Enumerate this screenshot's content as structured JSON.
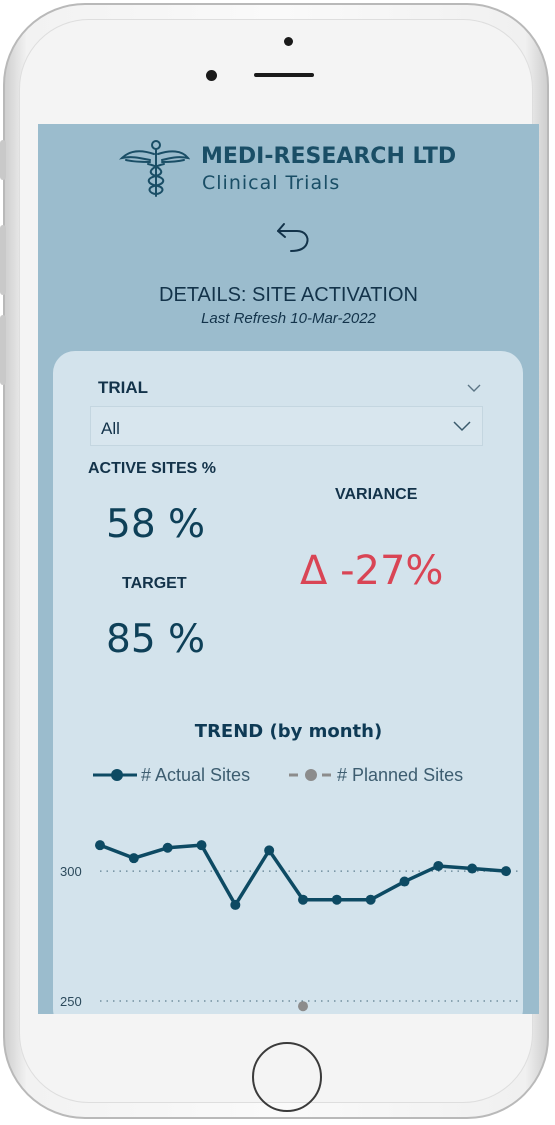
{
  "app": {
    "brand_name": "MEDI-RESEARCH LTD",
    "brand_subtitle": "Clinical Trials",
    "logo_icon": "caduceus-icon"
  },
  "page": {
    "title": "DETAILS: SITE ACTIVATION",
    "last_refresh": "Last Refresh 10-Mar-2022",
    "back_icon": "back-arrow-icon"
  },
  "filter": {
    "label": "TRIAL",
    "selected": "All"
  },
  "kpis": {
    "active_label": "ACTIVE SITES %",
    "active_value": "58 %",
    "target_label": "TARGET",
    "target_value": "85 %",
    "variance_label": "VARIANCE",
    "variance_value": "Δ -27%"
  },
  "colors": {
    "actual": "#0d4a63",
    "planned": "#8c8c8c",
    "variance": "#d94555",
    "screen_bg": "#9bbccd",
    "card_bg": "#d3e3ec"
  },
  "chart_data": {
    "type": "line",
    "title": "TREND (by month)",
    "series": [
      {
        "name": "# Actual Sites",
        "values": [
          310,
          305,
          309,
          310,
          287,
          308,
          289,
          289,
          289,
          296,
          302,
          301,
          300
        ]
      },
      {
        "name": "# Planned Sites",
        "values": [
          null,
          null,
          null,
          null,
          null,
          null,
          248,
          null,
          null,
          null,
          null,
          null,
          null
        ]
      }
    ],
    "y_ticks": [
      "300",
      "250"
    ],
    "y_tick_values": [
      300,
      250
    ],
    "ylim": [
      245,
      322
    ],
    "legend_position": "top",
    "grid": true
  }
}
